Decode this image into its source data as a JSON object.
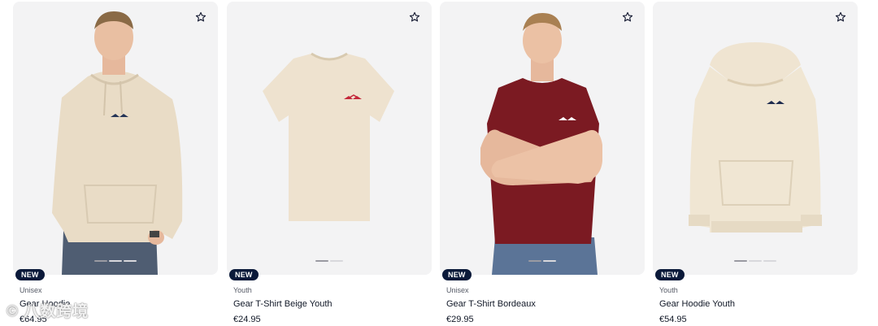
{
  "products": [
    {
      "badge": "NEW",
      "category": "Unisex",
      "name": "Gear Hoodie",
      "price": "€64.95",
      "favorite_icon": "star-outline-icon",
      "image": "man-wearing-beige-hoodie"
    },
    {
      "badge": "NEW",
      "category": "Youth",
      "name": "Gear T-Shirt Beige Youth",
      "price": "€24.95",
      "favorite_icon": "star-outline-icon",
      "image": "beige-t-shirt"
    },
    {
      "badge": "NEW",
      "category": "Unisex",
      "name": "Gear T-Shirt Bordeaux",
      "price": "€29.95",
      "favorite_icon": "star-outline-icon",
      "image": "man-wearing-bordeaux-t-shirt"
    },
    {
      "badge": "NEW",
      "category": "Youth",
      "name": "Gear Hoodie Youth",
      "price": "€54.95",
      "favorite_icon": "star-outline-icon",
      "image": "beige-youth-hoodie"
    }
  ],
  "watermark": "© 八数跨境",
  "colors": {
    "badge_bg": "#0b1a3a",
    "card_bg": "#f3f3f4",
    "beige": "#ece1cf",
    "bordeaux": "#7b1a22",
    "denim": "#5b7497"
  }
}
